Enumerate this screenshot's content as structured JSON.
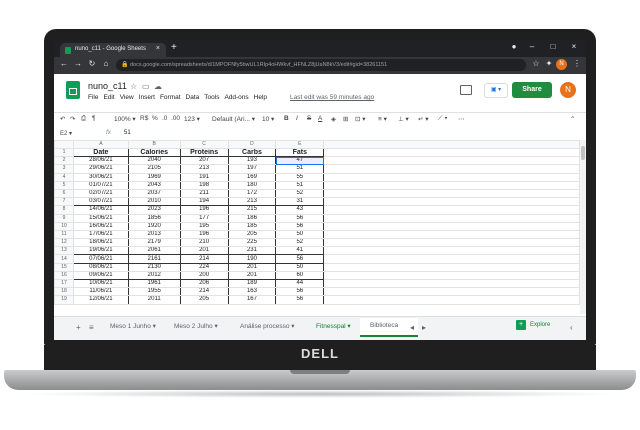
{
  "browser": {
    "tab_title": "nuno_c11 - Google Sheets",
    "new_tab_icon": "+",
    "url": "docs.google.com/spreadsheets/d/1MPOFNfy5bwUL1RIp4oHWkvf_HFNLZ8jUaN8kV3/edit#gid=38261151",
    "profile_initial": "N"
  },
  "app": {
    "doc_title": "nuno_c11",
    "menu": [
      "File",
      "Edit",
      "View",
      "Insert",
      "Format",
      "Data",
      "Tools",
      "Add-ons",
      "Help"
    ],
    "last_edit": "Last edit was 59 minutes ago",
    "share_label": "Share",
    "user_initial": "N"
  },
  "toolbar": {
    "zoom": "100%",
    "currency": "R$",
    "percent": "%",
    "dec_decrease": ".0",
    "dec_increase": ".00",
    "format_more": "123",
    "font": "Default (Ari...",
    "font_size": "10"
  },
  "formula_bar": {
    "cell_ref": "E2",
    "fx": "fx",
    "value": "51"
  },
  "grid": {
    "columns": [
      "A",
      "B",
      "C",
      "D",
      "E"
    ],
    "header_row_num": "1",
    "headers": [
      "Date",
      "Calories",
      "Proteins",
      "Carbs",
      "Fats"
    ],
    "rows": [
      {
        "n": "2",
        "cells": [
          "28/06/21",
          "2040",
          "207",
          "193",
          "47"
        ]
      },
      {
        "n": "3",
        "cells": [
          "29/06/21",
          "2105",
          "213",
          "197",
          "51"
        ]
      },
      {
        "n": "4",
        "cells": [
          "30/06/21",
          "1969",
          "191",
          "169",
          "55"
        ]
      },
      {
        "n": "5",
        "cells": [
          "01/07/21",
          "2043",
          "198",
          "180",
          "51"
        ]
      },
      {
        "n": "6",
        "cells": [
          "02/07/21",
          "2037",
          "211",
          "172",
          "52"
        ]
      },
      {
        "n": "7",
        "cells": [
          "03/07/21",
          "2010",
          "194",
          "213",
          "31"
        ]
      },
      {
        "n": "8",
        "cells": [
          "14/06/21",
          "2023",
          "196",
          "215",
          "43"
        ]
      },
      {
        "n": "9",
        "cells": [
          "15/06/21",
          "1856",
          "177",
          "186",
          "56"
        ]
      },
      {
        "n": "10",
        "cells": [
          "16/06/21",
          "1920",
          "195",
          "185",
          "56"
        ]
      },
      {
        "n": "11",
        "cells": [
          "17/06/21",
          "2013",
          "196",
          "205",
          "50"
        ]
      },
      {
        "n": "12",
        "cells": [
          "18/06/21",
          "2179",
          "210",
          "225",
          "52"
        ]
      },
      {
        "n": "13",
        "cells": [
          "19/06/21",
          "2061",
          "201",
          "231",
          "41"
        ]
      },
      {
        "n": "14",
        "cells": [
          "07/06/21",
          "2161",
          "214",
          "190",
          "56"
        ]
      },
      {
        "n": "15",
        "cells": [
          "08/06/21",
          "2130",
          "224",
          "201",
          "50"
        ]
      },
      {
        "n": "16",
        "cells": [
          "09/06/21",
          "2012",
          "200",
          "201",
          "60"
        ]
      },
      {
        "n": "17",
        "cells": [
          "10/06/21",
          "1961",
          "206",
          "189",
          "44"
        ]
      },
      {
        "n": "18",
        "cells": [
          "11/06/21",
          "1955",
          "214",
          "163",
          "56"
        ]
      },
      {
        "n": "19",
        "cells": [
          "12/06/21",
          "2011",
          "205",
          "167",
          "56"
        ]
      }
    ]
  },
  "sheet_tabs": {
    "add_icon": "+",
    "list_icon": "≡",
    "tabs": [
      "Meso 1 Junho",
      "Meso 2 Julho",
      "Análise processo",
      "Fitnesspal",
      "Biblioteca"
    ],
    "active_index": 3,
    "explore_label": "Explore"
  },
  "device": {
    "brand": "DELL"
  },
  "colors": {
    "sheets_green": "#0f9d58",
    "share_green": "#1e8e3e",
    "selection_blue": "#1a73e8",
    "avatar_orange": "#e8711c"
  }
}
